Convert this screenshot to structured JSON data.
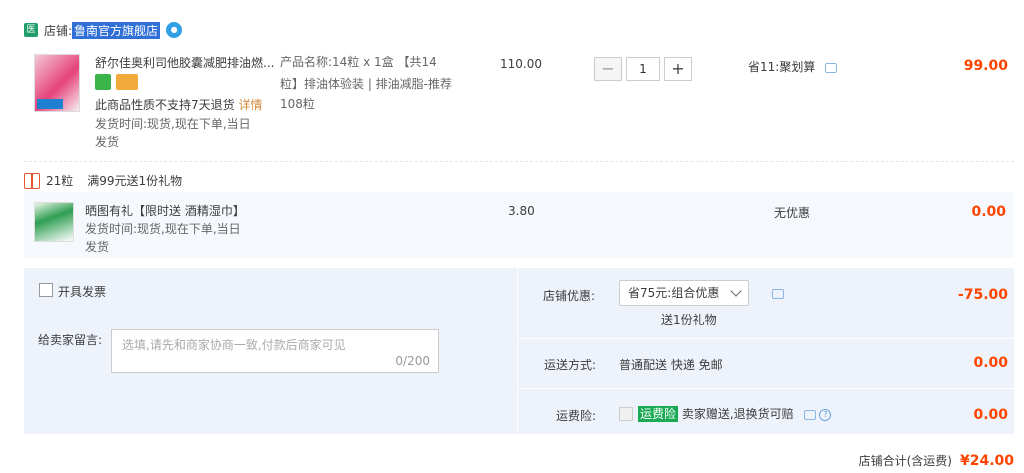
{
  "store": {
    "tag": "医",
    "label": "店铺:",
    "name": "鲁南官方旗舰店"
  },
  "item1": {
    "title": "舒尔佳奥利司他胶囊减肥排油燃...",
    "notice": "此商品性质不支持7天退货",
    "notice_link": "详情",
    "ship_line1": "发货时间:现货,现在下单,当日",
    "ship_line2": "发货",
    "attr_line1": "产品名称:14粒 x 1盒 【共14",
    "attr_line2": "粒】排油体验装 | 排油减脂-推荐",
    "attr_line3": "108粒",
    "unit_price": "110.00",
    "quantity": "1",
    "discount": "省11:聚划算",
    "subtotal": "99.00"
  },
  "gift": {
    "count": "21粒",
    "text": "满99元送1份礼物"
  },
  "item2": {
    "title": "晒图有礼【限时送 酒精湿巾】",
    "ship_line1": "发货时间:现货,现在下单,当日",
    "ship_line2": "发货",
    "unit_price": "3.80",
    "discount": "无优惠",
    "subtotal": "0.00"
  },
  "invoice": {
    "label": "开具发票"
  },
  "message": {
    "label": "给卖家留言:",
    "placeholder": "选填,请先和商家协商一致,付款后商家可见",
    "counter": "0/200"
  },
  "store_discount": {
    "label": "店铺优惠:",
    "selected": "省75元:组合优惠",
    "sub": "送1份礼物",
    "amount": "-75.00"
  },
  "shipping": {
    "label": "运送方式:",
    "method": "普通配送 快递 免邮",
    "amount": "0.00"
  },
  "insurance": {
    "label": "运费险:",
    "badge": "运费险",
    "text": "卖家赠送,退换货可赔",
    "amount": "0.00"
  },
  "total": {
    "label": "店铺合计(含运费)",
    "amount": "¥24.00"
  },
  "colors": {
    "accent": "#ff4400",
    "store_highlight": "#2f6fd6",
    "badge_green": "#1aaa55"
  }
}
